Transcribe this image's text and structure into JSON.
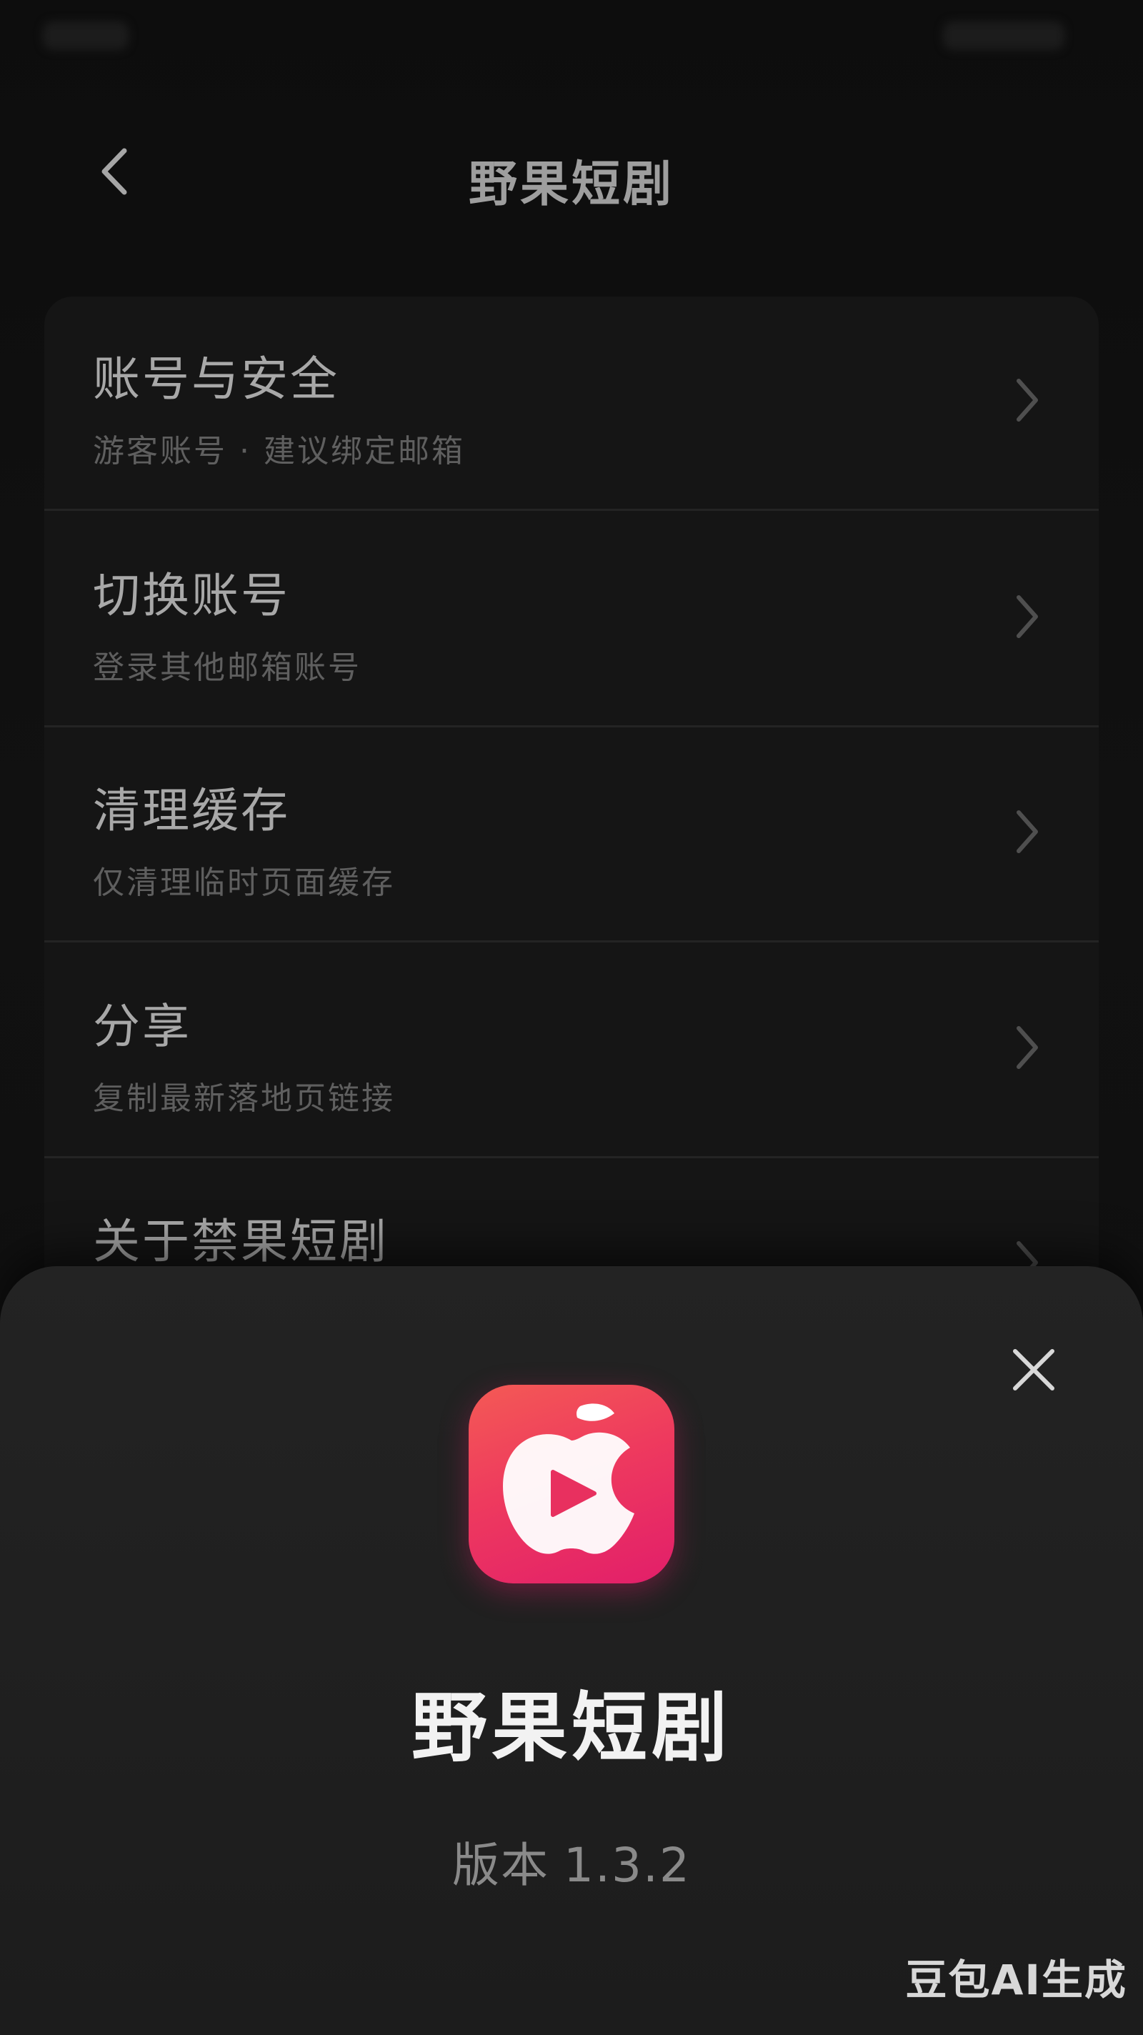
{
  "nav": {
    "title": "野果短剧"
  },
  "settings": {
    "items": [
      {
        "title": "账号与安全",
        "subtitle": "游客账号 · 建议绑定邮箱"
      },
      {
        "title": "切换账号",
        "subtitle": "登录其他邮箱账号"
      },
      {
        "title": "清理缓存",
        "subtitle": "仅清理临时页面缓存"
      },
      {
        "title": "分享",
        "subtitle": "复制最新落地页链接"
      },
      {
        "title": "关于禁果短剧",
        "subtitle": ""
      }
    ]
  },
  "about_sheet": {
    "app_name": "野果短剧",
    "version_label": "版本",
    "version_number": "1.3.2",
    "icon": "apple-play-app-icon",
    "icon_colors": [
      "#f45a55",
      "#ee3a5e",
      "#e21e6a"
    ]
  },
  "watermark": "豆包AI生成",
  "icons": {
    "back": "chevron-left-icon",
    "close": "close-icon",
    "item_arrow": "chevron-right-icon"
  },
  "theme": {
    "background": "#0d0d0d",
    "card": "#151515",
    "sheet": "#222222",
    "accent": "#e8305f"
  }
}
